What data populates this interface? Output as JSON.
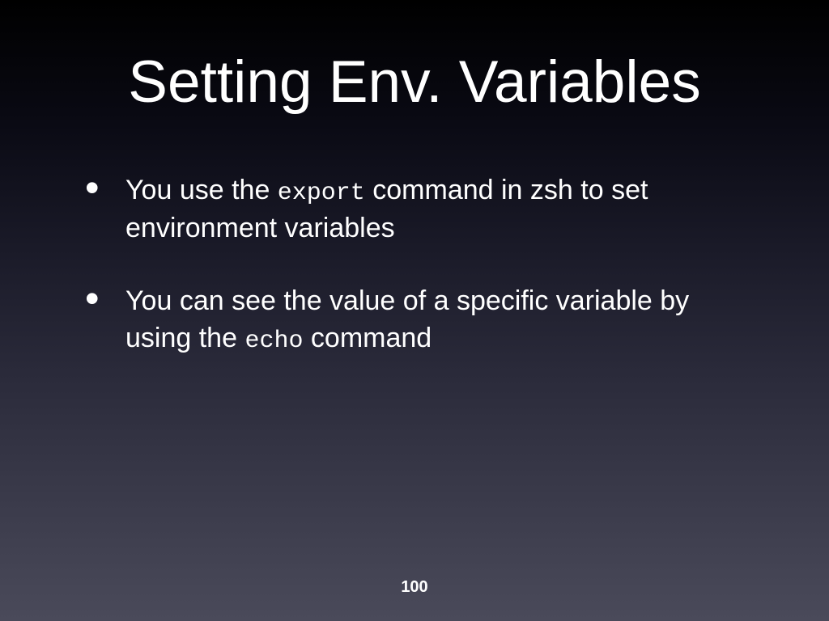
{
  "slide": {
    "title": "Setting Env. Variables",
    "bullets": [
      {
        "pre1": "You use the ",
        "code1": "export",
        "post1": " command in zsh to set environment variables"
      },
      {
        "pre1": "You can see the value of a specific variable by using the ",
        "code1": "echo",
        "post1": " command"
      }
    ],
    "pageNumber": "100"
  }
}
